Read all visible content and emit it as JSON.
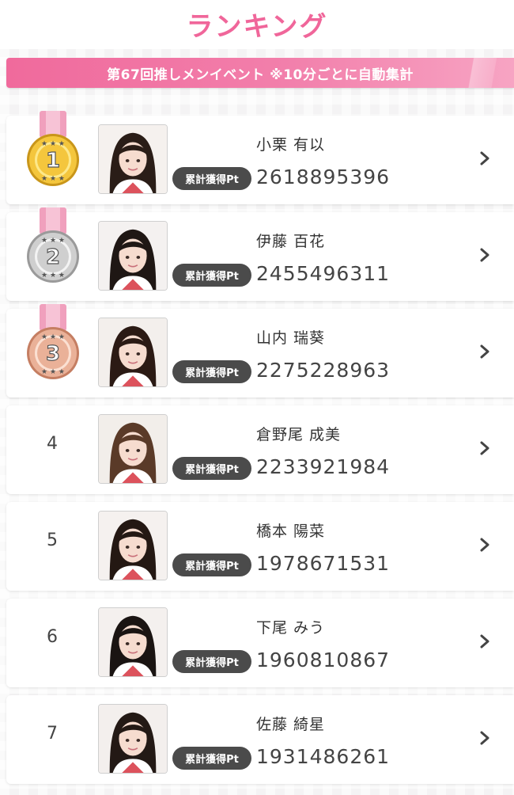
{
  "header": {
    "title": "ランキング"
  },
  "banner": {
    "text": "第67回推しメンイベント ※10分ごとに自動集計"
  },
  "colors": {
    "accent_pink": "#f0669a",
    "gold": "#f2c43c",
    "silver": "#c9c9c9",
    "bronze": "#e9ab90",
    "badge_dark": "#4b4b4b"
  },
  "ranking": [
    {
      "rank": "1",
      "medal": "gold-medal-icon",
      "name": "小栗 有以",
      "badge": "累計獲得Pt",
      "points": "2618895396"
    },
    {
      "rank": "2",
      "medal": "silver-medal-icon",
      "name": "伊藤 百花",
      "badge": "累計獲得Pt",
      "points": "2455496311"
    },
    {
      "rank": "3",
      "medal": "bronze-medal-icon",
      "name": "山内 瑞葵",
      "badge": "累計獲得Pt",
      "points": "2275228963"
    },
    {
      "rank": "4",
      "medal": "",
      "name": "倉野尾 成美",
      "badge": "累計獲得Pt",
      "points": "2233921984"
    },
    {
      "rank": "5",
      "medal": "",
      "name": "橋本 陽菜",
      "badge": "累計獲得Pt",
      "points": "1978671531"
    },
    {
      "rank": "6",
      "medal": "",
      "name": "下尾 みう",
      "badge": "累計獲得Pt",
      "points": "1960810867"
    },
    {
      "rank": "7",
      "medal": "",
      "name": "佐藤 綺星",
      "badge": "累計獲得Pt",
      "points": "1931486261"
    }
  ],
  "icons": {
    "row_chevron": "chevron-right-icon"
  }
}
